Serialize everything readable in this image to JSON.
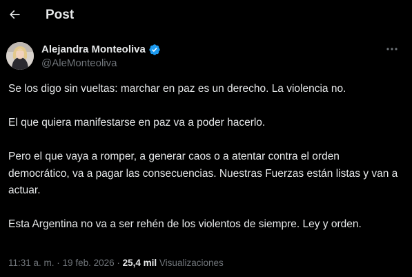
{
  "header": {
    "title": "Post",
    "back_icon": "arrow-left-icon"
  },
  "author": {
    "name": "Alejandra Monteoliva",
    "handle": "@AleMonteoliva",
    "verified_icon": "verified-badge-icon",
    "verified_color": "#1d9bf0"
  },
  "post": {
    "paragraphs": [
      "Se los digo sin vueltas: marchar en paz es un derecho. La violencia no.",
      "El que quiera manifestarse en paz va a poder hacerlo.",
      "Pero el que vaya a romper, a generar caos o a atentar contra el orden democrático, va a pagar las consecuencias. Nuestras Fuerzas están listas y van a actuar.",
      "Esta Argentina no va a ser rehén de los violentos de siempre. Ley y orden."
    ]
  },
  "meta": {
    "time": "11:31 a. m.",
    "separator": " · ",
    "date": "19 feb. 2026",
    "views_count": "25,4 mil",
    "views_label": "Visualizaciones"
  },
  "colors": {
    "background": "#000000",
    "text_primary": "#e7e9ea",
    "text_secondary": "#71767b",
    "accent": "#1d9bf0"
  }
}
